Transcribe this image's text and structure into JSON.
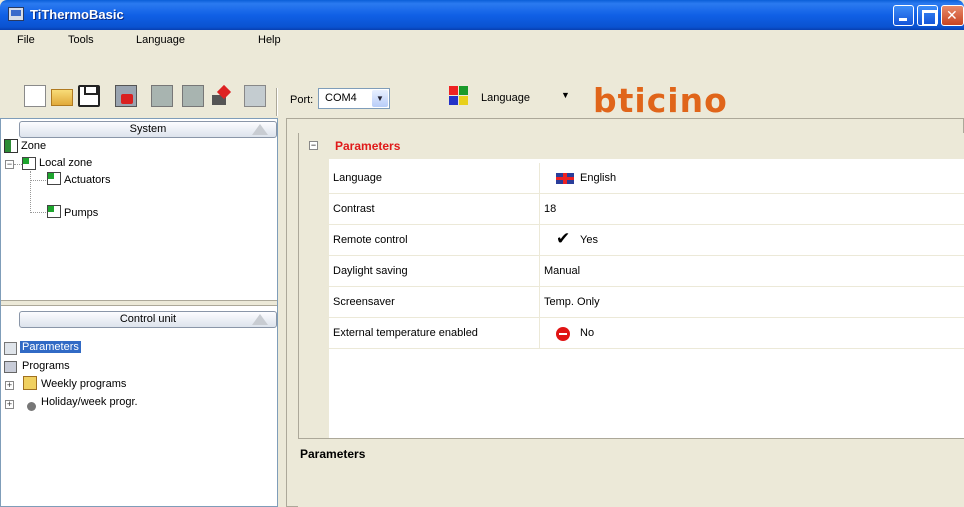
{
  "window": {
    "title": "TiThermoBasic"
  },
  "menu": [
    "File",
    "Tools",
    "Language",
    "Help"
  ],
  "toolbar": {
    "port_label": "Port:",
    "port_value": "COM4",
    "language_label": "Language",
    "brand": "bticino"
  },
  "system_panel": {
    "header": "System",
    "tree": {
      "root": "Zone",
      "local": "Local zone",
      "children": [
        "Actuators",
        "Pumps"
      ]
    }
  },
  "control_panel": {
    "header": "Control unit",
    "items": [
      "Parameters",
      "Programs",
      "Weekly programs",
      "Holiday/week progr."
    ]
  },
  "parameters": {
    "category": "Parameters",
    "rows": [
      {
        "name": "Language",
        "value": "English",
        "icon": "uk-flag-icon"
      },
      {
        "name": "Contrast",
        "value": "18"
      },
      {
        "name": "Remote control",
        "value": "Yes",
        "icon": "check-icon"
      },
      {
        "name": "Daylight saving",
        "value": "Manual"
      },
      {
        "name": "Screensaver",
        "value": "Temp. Only"
      },
      {
        "name": "External temperature enabled",
        "value": "No",
        "icon": "no-entry-icon"
      }
    ]
  },
  "description": {
    "title": "Parameters"
  },
  "colors": {
    "titlebar": "#0a5fd8",
    "brand": "#e0651a",
    "category": "#e01a1a",
    "selection": "#316ac5"
  }
}
